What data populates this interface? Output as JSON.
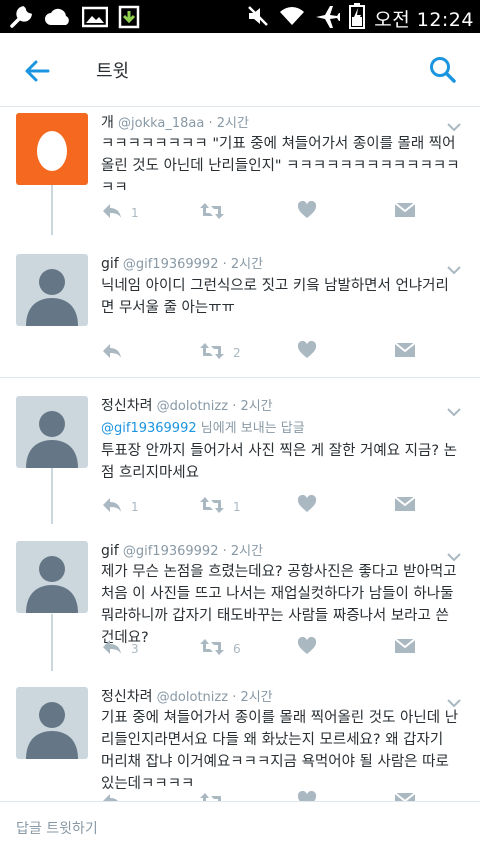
{
  "status_bar": {
    "time": "오전 12:24",
    "icons": [
      "wrench-icon",
      "cloud-icon",
      "image-icon",
      "download-icon",
      "mute-icon",
      "wifi-icon",
      "airplane-icon",
      "battery-charging-icon"
    ]
  },
  "app_bar": {
    "title": "트윗",
    "back_icon": "back-arrow-icon",
    "search_icon": "search-icon"
  },
  "colors": {
    "accent": "#1b95e0",
    "muted": "#8899a6",
    "action_icon": "#aab8c2",
    "avatar_default": "#ccd6dd",
    "avatar_egg": "#f4691f"
  },
  "tweets": [
    {
      "name": "개",
      "handle": "@jokka_18aa",
      "time": "· 2시간",
      "text": "ㅋㅋㅋㅋㅋㅋㅋㅋ \"기표 중에 쳐들어가서 종이를 몰래 찍어올린 것도 아닌데 난리들인지\" ㅋㅋㅋㅋㅋㅋㅋㅋㅋㅋㅋㅋㅋㅋㅋ",
      "reply_count": "1",
      "retweet_count": "",
      "avatar": "egg"
    },
    {
      "name": "gif",
      "handle": "@gif19369992",
      "time": "· 2시간",
      "text": "닉네임 아이디 그런식으로 짓고 키읔 남발하면서 언냐거리면 무서울 줄 아는ㅠㅠ",
      "reply_count": "",
      "retweet_count": "2",
      "avatar": "default"
    },
    {
      "name": "정신차려",
      "handle": "@dolotnizz",
      "time": "· 2시간",
      "reply_to_handle": "@gif19369992",
      "reply_to_suffix": " 님에게 보내는 답글",
      "text": "투표장 안까지 들어가서 사진 찍은 게 잘한 거예요 지금? 논점 흐리지마세요",
      "reply_count": "1",
      "retweet_count": "1",
      "avatar": "default"
    },
    {
      "name": "gif",
      "handle": "@gif19369992",
      "time": "· 2시간",
      "text": "제가 무슨 논점을 흐렸는데요? 공항사진은 좋다고 받아먹고 처음 이 사진들 뜨고 나서는 재업실컷하다가 남들이 하나둘 뭐라하니까 갑자기 태도바꾸는 사람들 짜증나서 보라고 쓴 건데요?",
      "reply_count": "3",
      "retweet_count": "6",
      "avatar": "default"
    },
    {
      "name": "정신차려",
      "handle": "@dolotnizz",
      "time": "· 2시간",
      "text": "기표 중에 쳐들어가서 종이를 몰래 찍어올린 것도 아닌데 난리들인지라면서요 다들 왜 화났는지 모르세요? 왜 갑자기 머리채 잡냐 이거예요ㅋㅋㅋ지금 욕먹어야 될 사람은 따로 있는데ㅋㅋㅋㅋ",
      "reply_count": "",
      "retweet_count": "",
      "avatar": "default"
    }
  ],
  "reply_bar": {
    "placeholder": "답글 트윗하기"
  }
}
